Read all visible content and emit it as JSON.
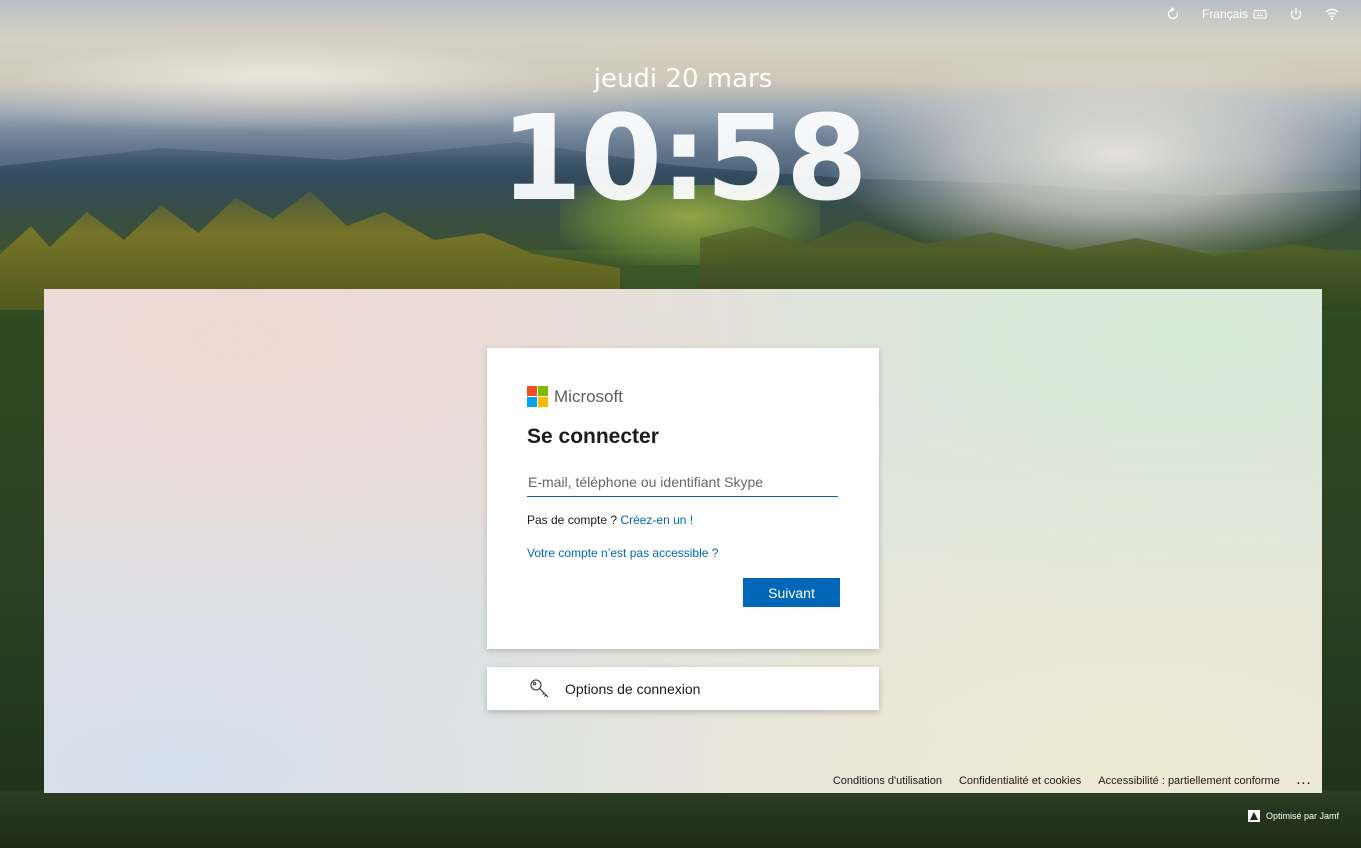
{
  "menubar": {
    "language": "Français",
    "icons": [
      "restart-icon",
      "keyboard-icon",
      "power-icon",
      "wifi-icon"
    ]
  },
  "lockscreen": {
    "date": "jeudi 20 mars",
    "time": "10:58"
  },
  "signin": {
    "brand": "Microsoft",
    "brand_colors": [
      "#f25022",
      "#7fba00",
      "#00a4ef",
      "#ffb900"
    ],
    "title": "Se connecter",
    "email_placeholder": "E-mail, téléphone ou identifiant Skype",
    "email_value": "",
    "no_account_text": "Pas de compte ?",
    "create_link": "Créez-en un !",
    "inaccessible_link": "Votre compte n’est pas accessible ?",
    "next_button": "Suivant",
    "accent_color": "#0067b8"
  },
  "options": {
    "label": "Options de connexion",
    "icon": "key-icon"
  },
  "footer": {
    "terms": "Conditions d'utilisation",
    "privacy": "Confidentialité et cookies",
    "accessibility": "Accessibilité : partiellement conforme",
    "more": "..."
  },
  "jamf": {
    "label": "Optimisé par Jamf"
  }
}
